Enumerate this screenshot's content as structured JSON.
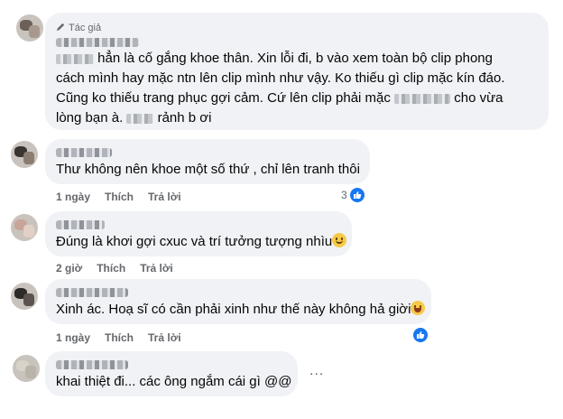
{
  "comments": [
    {
      "badge": "Tác giả",
      "lines": [
        [
          "",
          " hẳn là cố gắng khoe thân. Xin lỗi đi, b vào xem toàn bộ clip phong"
        ],
        [
          "cách mình hay mặc ntn lên clip mình như vậy. Ko thiếu gì clip mặc kín đáo."
        ],
        [
          "Cũng ko thiếu trang phục gợi cảm. Cứ lên clip phải mặc ",
          "",
          " cho vừa"
        ],
        [
          "lòng bạn à. ",
          "",
          " rảnh b ơi"
        ]
      ]
    },
    {
      "text": "Thư không nên khoe một số thứ , chỉ lên tranh thôi",
      "time": "1 ngày",
      "like": "Thích",
      "reply": "Trả lời",
      "reactions": "3"
    },
    {
      "text": "Đúng là khơi gợi cxuc và trí tưởng tượng nhìu",
      "emoji": "smile",
      "time": "2 giờ",
      "like": "Thích",
      "reply": "Trả lời"
    },
    {
      "text": "Xinh ác. Hoạ sĩ có cần phải xinh như thế này không hả giời",
      "emoji": "laugh",
      "time": "1 ngày",
      "like": "Thích",
      "reply": "Trả lời"
    },
    {
      "text": "khai thiệt đi... các ông ngắm cái gì @@",
      "more": "..."
    }
  ]
}
